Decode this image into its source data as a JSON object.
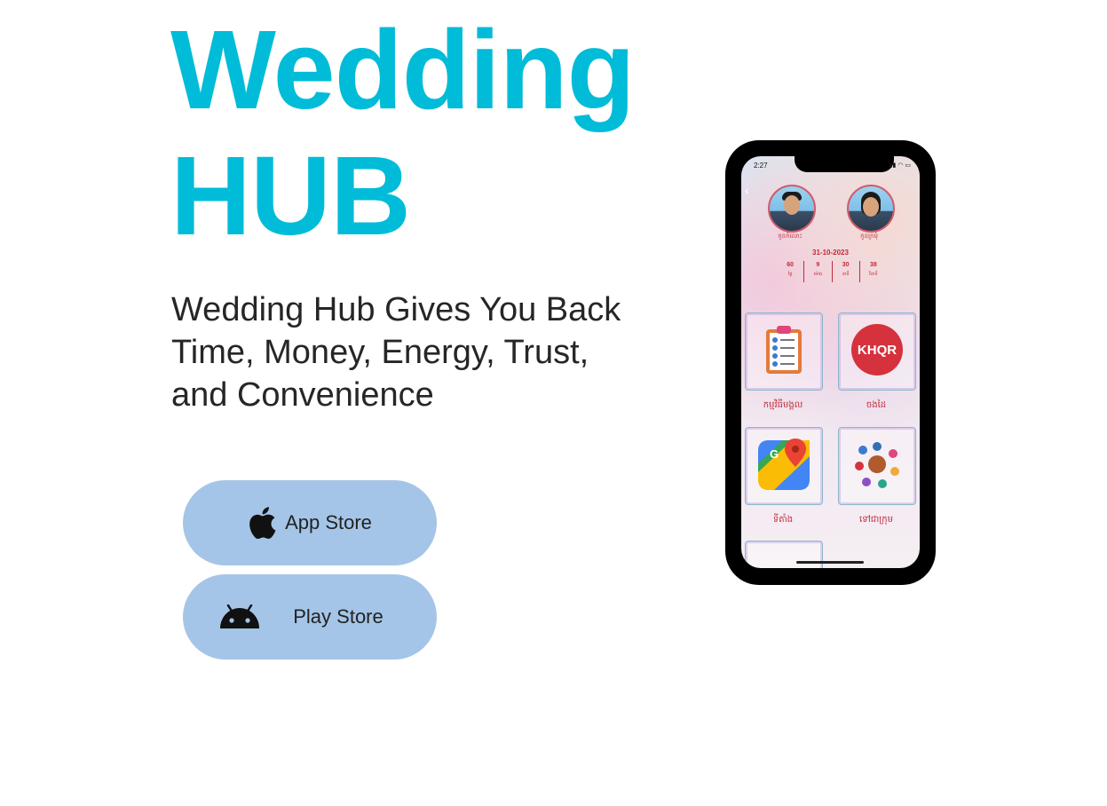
{
  "hero": {
    "title_line1": "Wedding",
    "title_line2": "HUB",
    "subtitle": "Wedding Hub Gives You Back Time, Money, Energy, Trust, and Convenience",
    "title_color": "#00bcd8"
  },
  "buttons": {
    "app_store": {
      "label": "App Store",
      "icon": "apple-icon"
    },
    "play_store": {
      "label": "Play Store",
      "icon": "android-icon"
    },
    "background": "#a4c5e7"
  },
  "phone_screen": {
    "status_time": "2:27",
    "groom_label": "កូនកំលោះ",
    "bride_label": "កូនក្រមុំ",
    "date": "31-10-2023",
    "countdown": [
      {
        "value": "60",
        "unit": "ថ្ងៃ"
      },
      {
        "value": "9",
        "unit": "ម៉ោង"
      },
      {
        "value": "30",
        "unit": "នាទី"
      },
      {
        "value": "38",
        "unit": "វិនាទី"
      }
    ],
    "tiles": [
      {
        "label": "កម្មវិធីមង្គល",
        "icon": "clipboard-checklist-icon"
      },
      {
        "label": "ចងដៃ",
        "icon": "khqr-icon",
        "icon_text": "KHQR"
      },
      {
        "label": "ទីតាំង",
        "icon": "google-maps-icon",
        "icon_text": "G"
      },
      {
        "label": "ទៅជាក្រុម",
        "icon": "group-people-icon"
      }
    ]
  }
}
